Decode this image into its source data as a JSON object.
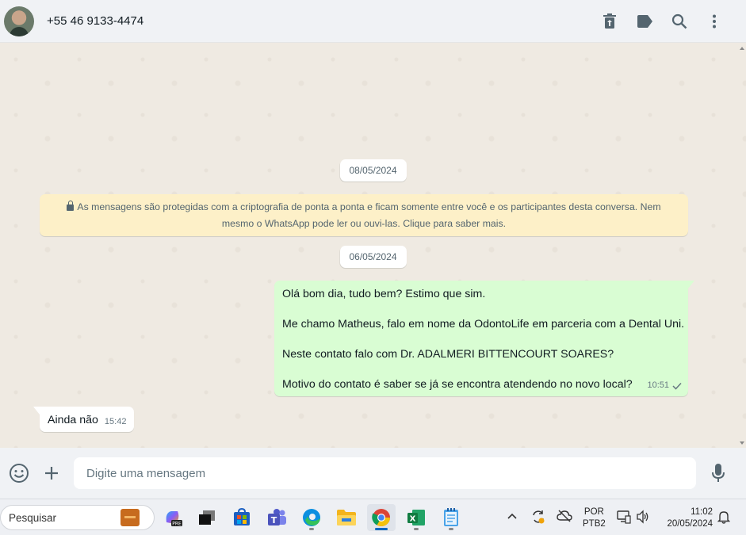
{
  "header": {
    "contact_name": "+55 46 9133-4474",
    "icons": [
      "delete-icon",
      "label-icon",
      "search-icon",
      "menu-icon"
    ]
  },
  "chat": {
    "date_1": "08/05/2024",
    "encryption_line_1": "As mensagens são protegidas com a criptografia de ponta a ponta e ficam somente entre você e os participantes desta conversa. Nem",
    "encryption_line_2": "mesmo o WhatsApp pode ler ou ouvi-las. Clique para saber mais.",
    "date_2": "06/05/2024",
    "outgoing": {
      "lines": [
        "Olá bom dia, tudo bem? Estimo que sim.",
        "Me chamo Matheus, falo em nome da OdontoLife em parceria com a Dental Uni.",
        "Neste contato falo com Dr. ADALMERI BITTENCOURT SOARES?",
        "Motivo do contato é saber se já se encontra atendendo no novo local?"
      ],
      "time": "10:51",
      "status": "sent"
    },
    "incoming": {
      "text": "Ainda não",
      "time": "15:42"
    }
  },
  "composer": {
    "placeholder": "Digite uma mensagem"
  },
  "taskbar": {
    "search_placeholder": "Pesquisar",
    "apps": [
      "copilot",
      "task-view",
      "microsoft-store",
      "teams",
      "edge",
      "file-explorer",
      "chrome",
      "excel",
      "notepad"
    ],
    "language": "POR",
    "layout": "PTB2",
    "time": "11:02",
    "date": "20/05/2024"
  }
}
